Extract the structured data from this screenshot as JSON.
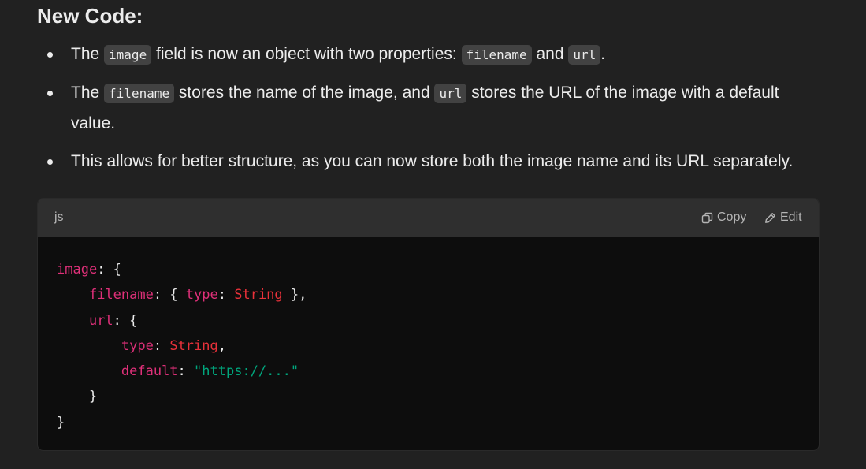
{
  "heading": "New Code:",
  "bullets": [
    {
      "t1": "The ",
      "c1": "image",
      "t2": " field is now an object with two properties: ",
      "c2": "filename",
      "t3": " and ",
      "c3": "url",
      "t4": "."
    },
    {
      "t1": "The ",
      "c1": "filename",
      "t2": " stores the name of the image, and ",
      "c2": "url",
      "t3": " stores the URL of the image with a default value."
    },
    {
      "t1": "This allows for better structure, as you can now store both the image name and its URL separately."
    }
  ],
  "code_block": {
    "language": "js",
    "copy_label": "Copy",
    "edit_label": "Edit",
    "icons": {
      "copy": "copy-icon",
      "edit": "pencil-icon"
    },
    "lines": [
      {
        "indent": "",
        "k": "image",
        "r": ": {"
      },
      {
        "indent": "    ",
        "k": "filename",
        "p1": ": { ",
        "k2": "type",
        "p2": ": ",
        "v": "String",
        "p3": " },"
      },
      {
        "indent": "    ",
        "k": "url",
        "r": ": {"
      },
      {
        "indent": "        ",
        "k": "type",
        "p1": ": ",
        "v": "String",
        "p2": ","
      },
      {
        "indent": "        ",
        "k": "default",
        "p1": ": ",
        "s": "\"https://...\""
      },
      {
        "indent": "    ",
        "r": "}"
      },
      {
        "indent": "",
        "r": "}"
      }
    ],
    "colors": {
      "key": "#df3079",
      "type": "#e9313a",
      "string": "#00a67d",
      "punct": "#ececec",
      "background": "#0d0d0d",
      "header": "#2f2f2f"
    }
  }
}
